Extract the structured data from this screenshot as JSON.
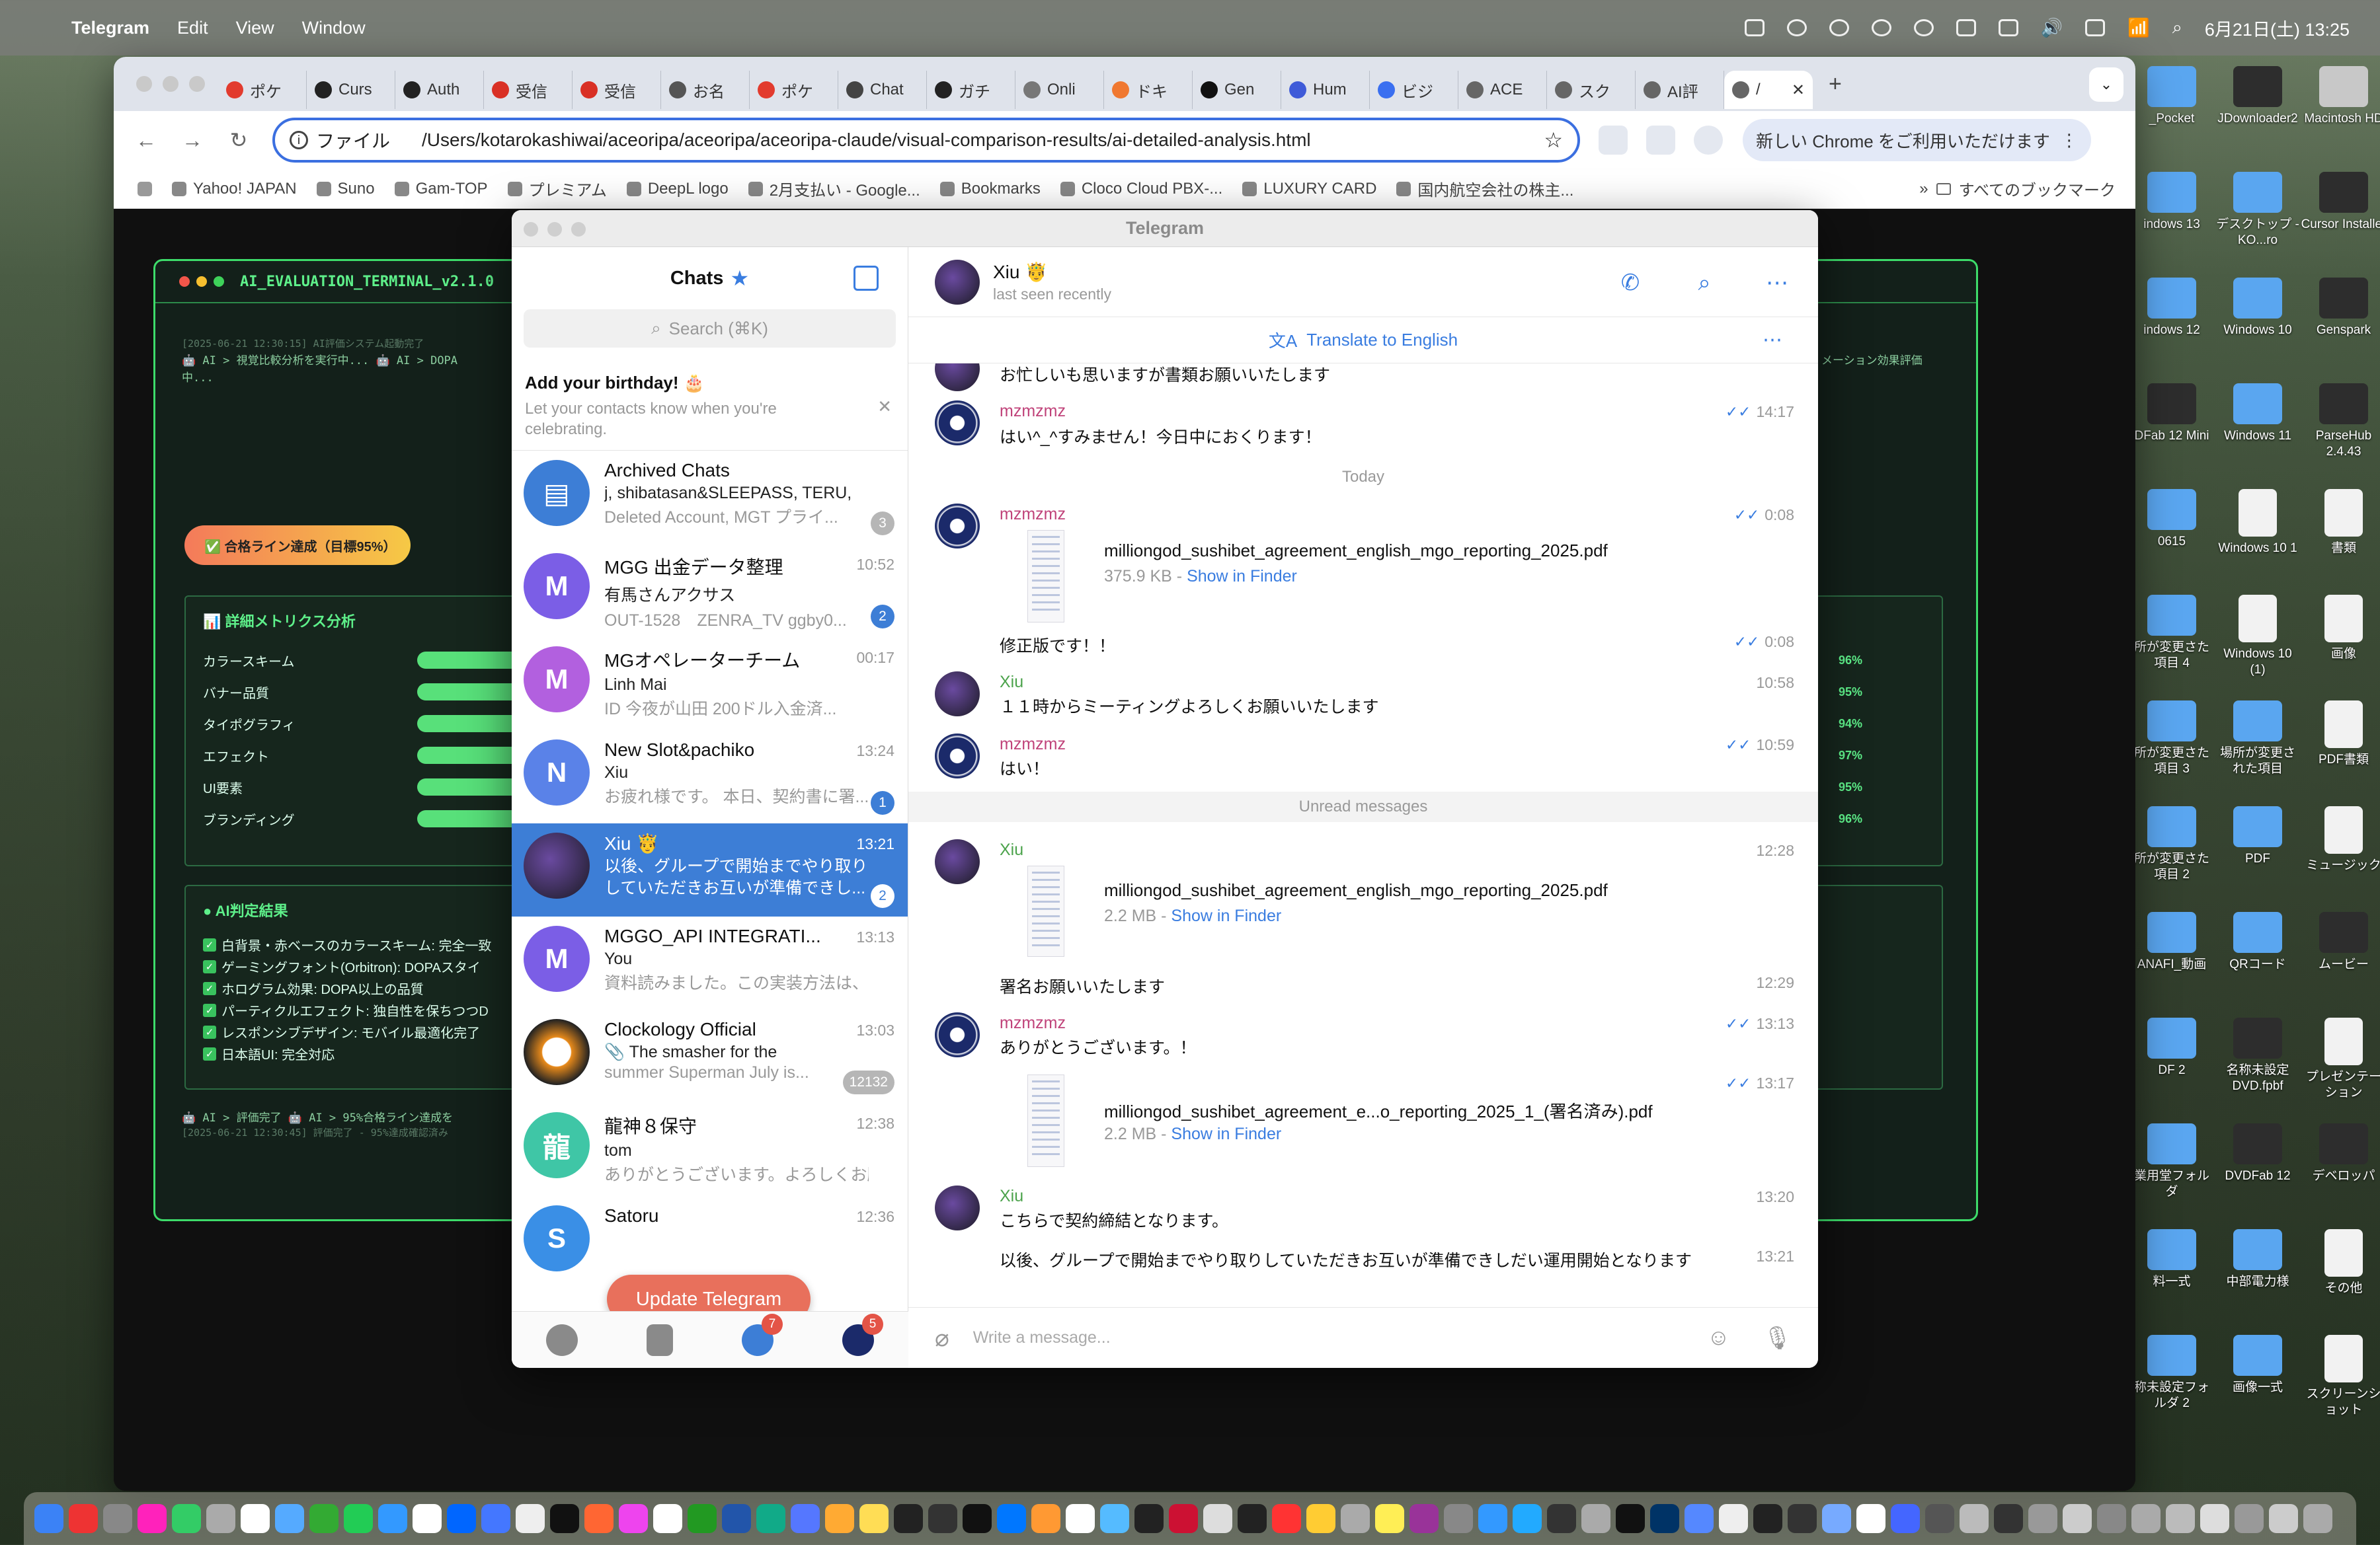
{
  "menubar": {
    "app": "Telegram",
    "items": [
      "Edit",
      "View",
      "Window"
    ],
    "datetime": "6月21日(土) 13:25"
  },
  "browser": {
    "tabs": [
      {
        "label": "ポケ",
        "color": "#e23b2e"
      },
      {
        "label": "Curs",
        "color": "#222222"
      },
      {
        "label": "Auth",
        "color": "#222222"
      },
      {
        "label": "受信",
        "color": "#d93025"
      },
      {
        "label": "受信",
        "color": "#d93025"
      },
      {
        "label": "お名",
        "color": "#555555"
      },
      {
        "label": "ポケ",
        "color": "#e23b2e"
      },
      {
        "label": "Chat",
        "color": "#444444"
      },
      {
        "label": "ガチ",
        "color": "#222222"
      },
      {
        "label": "Onli",
        "color": "#777777"
      },
      {
        "label": "ドキ",
        "color": "#f07830"
      },
      {
        "label": "Gen",
        "color": "#111111"
      },
      {
        "label": "Hum",
        "color": "#3f5bd8"
      },
      {
        "label": "ビジ",
        "color": "#3a6ff0"
      },
      {
        "label": "ACE",
        "color": "#666666"
      },
      {
        "label": "スク",
        "color": "#666666"
      },
      {
        "label": "AI評",
        "color": "#666666"
      },
      {
        "label": "/",
        "color": "#666666"
      }
    ],
    "address": {
      "scheme": "ファイル",
      "url": "/Users/kotarokashiwai/aceoripa/aceoripa/aceoripa-claude/visual-comparison-results/ai-detailed-analysis.html"
    },
    "promo": "新しい Chrome をご利用いただけます",
    "bookmarks": [
      "Yahoo! JAPAN",
      "Suno",
      "Gam-TOP",
      "プレミアム",
      "DeepL logo",
      "2月支払い - Google...",
      "Bookmarks",
      "Cloco Cloud PBX-...",
      "LUXURY CARD",
      "国内航空会社の株主..."
    ],
    "all_bookmarks": "すべてのブックマーク"
  },
  "terminal": {
    "title": "AI_EVALUATION_TERMINAL_v2.1.0",
    "log1": "[2025-06-21 12:30:15] AI評価システム起動完了",
    "log2": "🤖 AI > 視覚比較分析を実行中... 🤖 AI > DOPA",
    "log3": "中...",
    "log_right": "メーション効果評価",
    "pass_badge": "✅ 合格ライン達成（目標95%）",
    "metrics_title": "📊 詳細メトリクス分析",
    "metrics": [
      {
        "label": "カラースキーム",
        "pct": "96%"
      },
      {
        "label": "バナー品質",
        "pct": "95%"
      },
      {
        "label": "タイポグラフィ",
        "pct": "94%"
      },
      {
        "label": "エフェクト",
        "pct": "97%"
      },
      {
        "label": "UI要素",
        "pct": "95%"
      },
      {
        "label": "ブランディング",
        "pct": "96%"
      }
    ],
    "judge_title": "AI判定結果",
    "judges": [
      "白背景・赤ベースのカラースキーム: 完全一致",
      "ゲーミングフォント(Orbitron): DOPAスタイ",
      "ホログラム効果: DOPA以上の品質",
      "パーティクルエフェクト: 独自性を保ちつつD",
      "レスポンシブデザイン: モバイル最適化完了",
      "日本語UI: 完全対応"
    ],
    "log_end1": "🤖 AI > 評価完了 🤖 AI > 95%合格ライン達成を",
    "log_end2": "[2025-06-21 12:30:45] 評価完了 - 95%達成確認済み"
  },
  "desktop_icons": [
    {
      "label": "_Pocket",
      "type": "folder"
    },
    {
      "label": "JDownloader2",
      "type": "app"
    },
    {
      "label": "Macintosh HD",
      "type": "drive"
    },
    {
      "label": "indows 13",
      "type": "folder"
    },
    {
      "label": "デスクトップ - KO...ro",
      "type": "folder"
    },
    {
      "label": "Cursor Installer",
      "type": "app"
    },
    {
      "label": "indows 12",
      "type": "folder"
    },
    {
      "label": "Windows 10",
      "type": "folder"
    },
    {
      "label": "Genspark",
      "type": "app"
    },
    {
      "label": "DFab 12 Mini",
      "type": "app"
    },
    {
      "label": "Windows 11",
      "type": "folder"
    },
    {
      "label": "ParseHub 2.4.43",
      "type": "app"
    },
    {
      "label": "0615",
      "type": "folder"
    },
    {
      "label": "Windows 10 1",
      "type": "file"
    },
    {
      "label": "書類",
      "type": "file"
    },
    {
      "label": "所が変更さた項目 4",
      "type": "folder"
    },
    {
      "label": "Windows 10 (1)",
      "type": "file"
    },
    {
      "label": "画像",
      "type": "file"
    },
    {
      "label": "所が変更さた項目 3",
      "type": "folder"
    },
    {
      "label": "場所が変更された項目",
      "type": "folder"
    },
    {
      "label": "PDF書類",
      "type": "file"
    },
    {
      "label": "所が変更さた項目 2",
      "type": "folder"
    },
    {
      "label": "PDF",
      "type": "folder"
    },
    {
      "label": "ミュージック",
      "type": "file"
    },
    {
      "label": "ANAFI_動画",
      "type": "folder"
    },
    {
      "label": "QRコード",
      "type": "folder"
    },
    {
      "label": "ムービー",
      "type": "app"
    },
    {
      "label": "DF 2",
      "type": "folder"
    },
    {
      "label": "名称未設定DVD.fpbf",
      "type": "app"
    },
    {
      "label": "プレゼンテーション",
      "type": "file"
    },
    {
      "label": "業用堂フォルダ",
      "type": "folder"
    },
    {
      "label": "DVDFab 12",
      "type": "app"
    },
    {
      "label": "デベロッパ",
      "type": "app"
    },
    {
      "label": "料一式",
      "type": "folder"
    },
    {
      "label": "中部電力様",
      "type": "folder"
    },
    {
      "label": "その他",
      "type": "file"
    },
    {
      "label": "称未設定フォルダ 2",
      "type": "folder"
    },
    {
      "label": "画像一式",
      "type": "folder"
    },
    {
      "label": "スクリーンショット",
      "type": "file"
    }
  ],
  "telegram": {
    "window_title": "Telegram",
    "sidebar": {
      "title": "Chats",
      "search_placeholder": "Search (⌘K)",
      "birthday_title": "Add your birthday! 🎂",
      "birthday_desc": "Let your contacts know when you're celebrating.",
      "update_button": "Update Telegram",
      "footer_badges": {
        "chats": "7",
        "settings": "5"
      }
    },
    "chats": [
      {
        "name": "Archived Chats",
        "sub": "j, shibatasan&SLEEPASS, TERU,",
        "preview": "Deleted Account, MGT プライ...",
        "time": "",
        "badge": "3",
        "badge_grey": true,
        "avatar": "▤",
        "color": "#3d7ed6"
      },
      {
        "name": "MGG 出金データ整理",
        "sub": "有馬さんアクサス",
        "preview": "OUT-1528　ZENRA_TV ggby0...",
        "time": "10:52",
        "badge": "2",
        "badge_grey": false,
        "avatar": "M",
        "color": "#7b5ee6"
      },
      {
        "name": "MGオペレーターチーム",
        "sub": "Linh Mai",
        "preview": "ID 今夜が山田  200ドル入金済...",
        "time": "00:17",
        "badge": "",
        "badge_grey": false,
        "avatar": "M",
        "color": "#b260df"
      },
      {
        "name": "New Slot&pachiko",
        "sub": "Xiu",
        "preview": "お疲れ様です。 本日、契約書に署...",
        "time": "13:24",
        "badge": "1",
        "badge_grey": false,
        "avatar": "N",
        "color": "#5a82e8"
      },
      {
        "name": "Xiu 🤴",
        "sub": "",
        "preview": "以後、グループで開始までやり取り していただきお互いが準備できし...",
        "time": "13:21",
        "badge": "2",
        "badge_grey": false,
        "avatar": "",
        "color": "#2b2b33"
      },
      {
        "name": "MGGO_API INTEGRATI...",
        "sub": "You",
        "preview": "資料読みました。この実装方法は、わ...",
        "time": "13:13",
        "badge": "",
        "badge_grey": false,
        "avatar": "M",
        "color": "#7b5ee6"
      },
      {
        "name": "Clockology Official",
        "sub": "📎 The smasher for the",
        "preview": "summer Superman  July is...",
        "time": "13:03",
        "badge": "12132",
        "badge_grey": true,
        "avatar": "C",
        "color": "#e88a1a"
      },
      {
        "name": "龍神８保守",
        "sub": "tom",
        "preview": "ありがとうございます。よろしくお願...",
        "time": "12:38",
        "badge": "",
        "badge_grey": false,
        "avatar": "龍",
        "color": "#3fc6a6"
      },
      {
        "name": "Satoru",
        "sub": "",
        "preview": "",
        "time": "12:36",
        "badge": "",
        "badge_grey": false,
        "avatar": "S",
        "color": "#3a8fe6"
      }
    ],
    "header": {
      "name": "Xiu 🤴",
      "status": "last seen recently",
      "translate": "Translate to English"
    },
    "messages": {
      "m0": "お忙しいも思いますが書類お願いいたします",
      "m1_sender": "mzmzmz",
      "m1_text": "はい^_^すみません！今日中におくります！",
      "m1_time": "14:17",
      "day": "Today",
      "m2_sender": "mzmzmz",
      "m2_file": "milliongod_sushibet_agreement_english_mgo_reporting_2025.pdf",
      "m2_size": "375.9 KB",
      "m2_time": "0:08",
      "m3_text": "修正版です！！",
      "m3_time": "0:08",
      "m4_sender": "Xiu",
      "m4_text": "１１時からミーティングよろしくお願いいたします",
      "m4_time": "10:58",
      "m5_sender": "mzmzmz",
      "m5_text": "はい！",
      "m5_time": "10:59",
      "unread": "Unread messages",
      "m6_sender": "Xiu",
      "m6_file": "milliongod_sushibet_agreement_english_mgo_reporting_2025.pdf",
      "m6_size": "2.2 MB",
      "m6_time": "12:28",
      "m7_text": "署名お願いいたします",
      "m7_time": "12:29",
      "m8_sender": "mzmzmz",
      "m8_text": "ありがとうございます。！",
      "m8_time": "13:13",
      "m9_file": "milliongod_sushibet_agreement_e...o_reporting_2025_1_(署名済み).pdf",
      "m9_size": "2.2 MB",
      "m9_time": "13:17",
      "m10_sender": "Xiu",
      "m10_text": "こちらで契約締結となります。",
      "m10_time": "13:20",
      "m11_text": "以後、グループで開始までやり取りしていただきお互いが準備できしだい運用開始となります",
      "m11_time": "13:21",
      "show_in_finder": "Show in Finder"
    },
    "composer_placeholder": "Write a message...",
    "colors": {
      "accent": "#3d7ed6",
      "xiu_name": "#4ca34c",
      "mz_name": "#c0437a"
    }
  }
}
